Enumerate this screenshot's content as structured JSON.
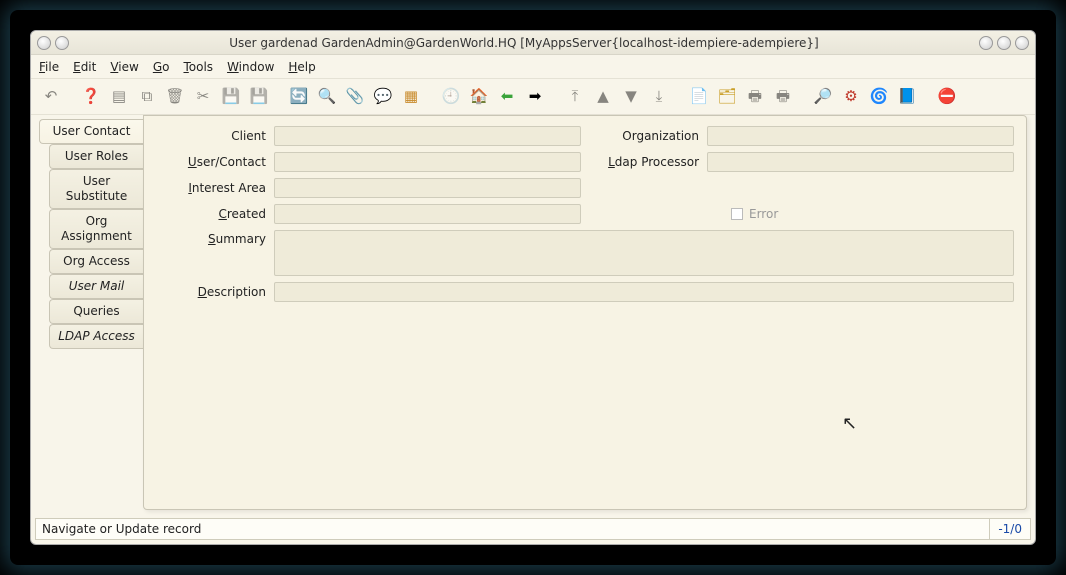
{
  "window": {
    "title": "User  gardenad  GardenAdmin@GardenWorld.HQ [MyAppsServer{localhost-idempiere-adempiere}]"
  },
  "menubar": [
    {
      "label": "File",
      "accel": "F"
    },
    {
      "label": "Edit",
      "accel": "E"
    },
    {
      "label": "View",
      "accel": "V"
    },
    {
      "label": "Go",
      "accel": "G"
    },
    {
      "label": "Tools",
      "accel": "T"
    },
    {
      "label": "Window",
      "accel": "W"
    },
    {
      "label": "Help",
      "accel": "H"
    }
  ],
  "toolbar": [
    {
      "name": "undo-icon",
      "glyph": "↶",
      "enabled": false
    },
    {
      "sep": true
    },
    {
      "name": "help-icon",
      "glyph": "❓",
      "enabled": true,
      "color": "#1560d8"
    },
    {
      "name": "new-icon",
      "glyph": "▤",
      "enabled": false
    },
    {
      "name": "copy-icon",
      "glyph": "⧉",
      "enabled": false
    },
    {
      "name": "delete-icon",
      "glyph": "🗑",
      "enabled": false
    },
    {
      "name": "delete-sel-icon",
      "glyph": "✂",
      "enabled": false
    },
    {
      "name": "save-icon",
      "glyph": "💾",
      "enabled": false
    },
    {
      "name": "save-new-icon",
      "glyph": "💾",
      "enabled": false
    },
    {
      "sep": true
    },
    {
      "name": "refresh-icon",
      "glyph": "🔄",
      "enabled": true,
      "color": "#2a7acb"
    },
    {
      "name": "find-icon",
      "glyph": "🔍",
      "enabled": true
    },
    {
      "name": "attach-icon",
      "glyph": "📎",
      "enabled": true
    },
    {
      "name": "chat-icon",
      "glyph": "💬",
      "enabled": true
    },
    {
      "name": "grid-icon",
      "glyph": "▦",
      "enabled": true,
      "color": "#c88a2a"
    },
    {
      "sep": true
    },
    {
      "name": "history-icon",
      "glyph": "🕘",
      "enabled": false
    },
    {
      "name": "home-icon",
      "glyph": "🏠",
      "enabled": true
    },
    {
      "name": "back-icon",
      "glyph": "⬅",
      "enabled": true,
      "color": "#3aa33a"
    },
    {
      "name": "forward-icon",
      "glyph": "➡",
      "enabled": true
    },
    {
      "sep": true
    },
    {
      "name": "first-icon",
      "glyph": "⤒",
      "enabled": false
    },
    {
      "name": "prev-icon",
      "glyph": "▲",
      "enabled": false
    },
    {
      "name": "next-icon",
      "glyph": "▼",
      "enabled": false
    },
    {
      "name": "last-icon",
      "glyph": "⤓",
      "enabled": false
    },
    {
      "sep": true
    },
    {
      "name": "report-icon",
      "glyph": "📄",
      "enabled": true
    },
    {
      "name": "archive-icon",
      "glyph": "🗂",
      "enabled": true,
      "color": "#caa02a"
    },
    {
      "name": "print-prev-icon",
      "glyph": "🖶",
      "enabled": false
    },
    {
      "name": "print-icon",
      "glyph": "🖶",
      "enabled": false
    },
    {
      "sep": true
    },
    {
      "name": "zoom-icon",
      "glyph": "🔎",
      "enabled": true
    },
    {
      "name": "process-icon",
      "glyph": "⚙",
      "enabled": true,
      "color": "#c0392b"
    },
    {
      "name": "workflow-icon",
      "glyph": "🌀",
      "enabled": true
    },
    {
      "name": "product-icon",
      "glyph": "📘",
      "enabled": true,
      "color": "#2a65c8"
    },
    {
      "sep": true
    },
    {
      "name": "close-icon",
      "glyph": "⛔",
      "enabled": true,
      "color": "#c0392b"
    }
  ],
  "tabs": [
    {
      "label": "User Contact",
      "active": true,
      "sub": false
    },
    {
      "label": "User Roles",
      "active": false,
      "sub": true
    },
    {
      "label": "User Substitute",
      "active": false,
      "sub": true
    },
    {
      "label": "Org Assignment",
      "active": false,
      "sub": true
    },
    {
      "label": "Org Access",
      "active": false,
      "sub": true
    },
    {
      "label": "User Mail",
      "active": false,
      "sub": true,
      "italic": true
    },
    {
      "label": "Queries",
      "active": false,
      "sub": true
    },
    {
      "label": "LDAP Access",
      "active": false,
      "sub": true,
      "italic": true
    }
  ],
  "form": {
    "client_label": "Client",
    "client_value": "",
    "org_label": "Organization",
    "org_value": "",
    "usercontact_label": "User/Contact",
    "usercontact_value": "",
    "ldap_label": "Ldap Processor",
    "ldap_value": "",
    "interest_label": "Interest Area",
    "interest_value": "",
    "created_label": "Created",
    "created_value": "",
    "error_label": "Error",
    "error_checked": false,
    "summary_label": "Summary",
    "summary_value": "",
    "description_label": "Description",
    "description_value": ""
  },
  "statusbar": {
    "message": "Navigate or Update record",
    "count": "-1/0"
  }
}
